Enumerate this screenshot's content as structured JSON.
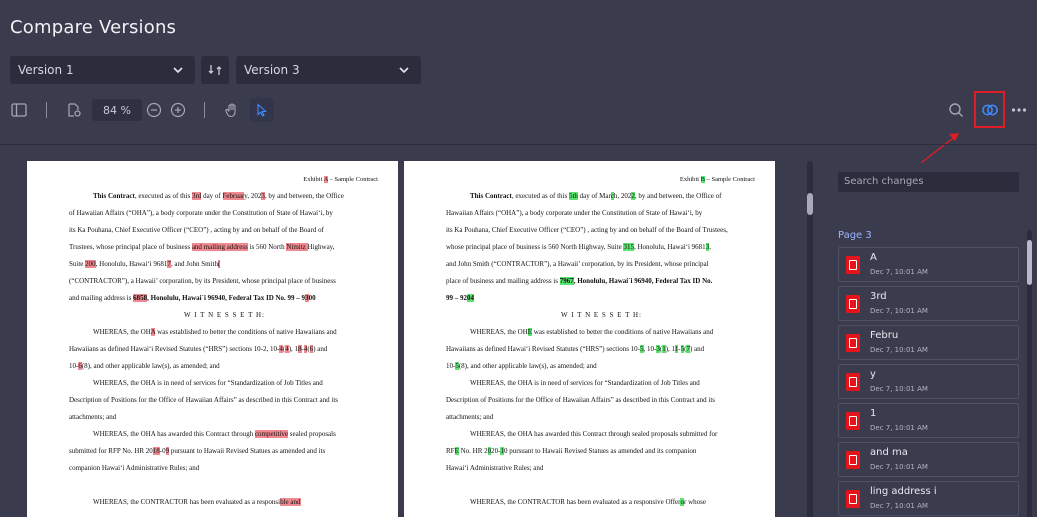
{
  "app": {
    "title": "Compare Versions"
  },
  "versions": {
    "left": "Version 1",
    "right": "Version 3"
  },
  "toolbar": {
    "zoom": "84 %"
  },
  "left_doc": {
    "exhibit_pre": "Exhibit ",
    "exhibit_hl": "A",
    "exhibit_post": " – Sample Contract",
    "l1a": "This Contract",
    "l1b": ", executed as of this ",
    "l1c": "3rd",
    "l1d": " day of ",
    "l1e": "Februar",
    "l1f": "y",
    "l1g": ", 202",
    "l1h": "3",
    "l1i": ", by and between, the Office",
    "l2": "of Hawaiian Affairs (“OHA”), a body corporate under the Constitution of State of Hawai‘i, by",
    "l3": "its Ka Pouhana, Chief Executive Officer (“CEO”) , acting by and on behalf of the Board of",
    "l4a": "Trustees, whose principal place of business ",
    "l4b": "and mailing address",
    "l4c": " is 560 North ",
    "l4d": "Nimitz ",
    "l4e": "Highway,",
    "l5a": "Suite ",
    "l5b": "200",
    "l5c": ", Honolulu, Hawai‘i 9681",
    "l5d": "7",
    "l5e": ", and John Smith",
    "l5f": "(",
    "l6": "(“CONTRACTOR”), a Hawaii’ corporation, by its President, whose principal place of business",
    "l7a": "and mailing address is ",
    "l7b": "6858",
    "l7c": ", Honolulu, Hawai`i  96940, Federal Tax ID No. 99 – 9",
    "l7d": "3",
    "l7e": "00",
    "wit": "W I T N E S S E T H:",
    "w1a": "WHEREAS, the OH",
    "w1b": "A",
    "w1c": " was established to better the conditions of native Hawaiians and",
    "w2a": "Hawaiians as defined Hawai‘i Revised Statutes (“HRS”) sections 10-2, 10-",
    "w2b": "4",
    "w2c": "(",
    "w2d": "4",
    "w2e": "), 1",
    "w2f": "8",
    "w2g": "-",
    "w2h": "4",
    "w2i": "(",
    "w2j": "6",
    "w2k": ") and",
    "w3a": "10-",
    "w3b": "6",
    "w3c": "(8), and other applicable law(s), as amended; and",
    "w4": "WHEREAS, the OHA is in need of services for “Standardization of Job Titles and",
    "w5": "Description of Positions for the Office of Hawaiian Affairs” as described in this Contract and its",
    "w6": "attachments; and",
    "w7a": "WHEREAS, the OHA has awarded this Contract through ",
    "w7b": "competitive",
    "w7c": " sealed proposals",
    "w8a": "submitted for RFP No. HR 20",
    "w8b": "18",
    "w8c": "-0",
    "w8d": "9",
    "w8e": " pursuant to Hawaii Revised Statues as amended and its",
    "w9": "companion Hawai‘i Administrative Rules; and",
    "w10a": "WHEREAS, the CONTRACTOR has been evaluated as a responsi",
    "w10b": "ble and"
  },
  "right_doc": {
    "exhibit_pre": "Exhibit ",
    "exhibit_hl": "B",
    "exhibit_post": " – Sample Contract",
    "l1a": "This Contract",
    "l1b": ", executed as of this ",
    "l1c": "5th",
    "l1d": " day of ",
    "l1e": "Mar",
    "l1f": "c",
    "l1g": "h",
    "l1h": ", 202",
    "l1i": "2",
    "l1j": ", by and between, the Office of",
    "l2": "Hawaiian Affairs (“OHA”), a body corporate under the Constitution of State of Hawai‘i, by",
    "l3": "its Ka Pouhana, Chief Executive Officer (“CEO”) , acting by and on behalf of the Board of Trustees,",
    "l4a": "whose principal place of business is 560 North Highway, Suite ",
    "l4b": "315",
    "l4c": ", Honolulu, Hawai‘i 9681",
    "l4d": "3",
    "l4e": ",",
    "l5": "and John Smith (“CONTRACTOR”), a Hawaii’ corporation, by its President, whose principal",
    "l6a": "place of business and mailing address is ",
    "l6b": "7967",
    "l6c": ", Honolulu, Hawai`i  96940, Federal Tax ID No.",
    "l7a": "99 – 92",
    "l7b": "04",
    "wit": "W I T N E S S E T H:",
    "w1a": "WHEREAS, the OH",
    "w1b": "E",
    "w1c": " was established to better the conditions of native Hawaiians and",
    "w2a": "Hawaiians as defined Hawai‘i Revised Statutes (“HRS”) sections 10-",
    "w2b": "5",
    "w2c": ", 10-",
    "w2d": "3",
    "w2e": "(",
    "w2f": "1",
    "w2g": "), 1",
    "w2h": "1",
    "w2i": "-",
    "w2j": "5",
    "w2k": "(",
    "w2l": "7",
    "w2m": ") and",
    "w3a": "10-",
    "w3b": "5",
    "w3c": "(8), and other applicable law(s), as amended; and",
    "w4": "WHEREAS, the OHA is in need of services for “Standardization of Job Titles and",
    "w5": "Description of Positions for the Office of Hawaiian Affairs” as described in this Contract and its",
    "w6": "attachments; and",
    "w7": "WHEREAS, the OHA has awarded this Contract through sealed proposals submitted for",
    "w8a": "RF",
    "w8b": "E",
    "w8c": " No. HR 2",
    "w8d": "0",
    "w8e": "20-",
    "w8f": "1",
    "w8g": "0 pursuant to Hawaii Revised Statues as amended and its companion",
    "w9": "Hawai‘i Administrative Rules; and",
    "w10a": "WHEREAS, the CONTRACTOR has been evaluated as a responsive Offer",
    "w10b": "o",
    "w10c": "r whose"
  },
  "sidebar": {
    "search_placeholder": "Search changes",
    "page_label": "Page 3",
    "changes": [
      {
        "text": "A",
        "date": "Dec 7, 10:01 AM"
      },
      {
        "text": "3rd",
        "date": "Dec 7, 10:01 AM"
      },
      {
        "text": "Febru",
        "date": "Dec 7, 10:01 AM"
      },
      {
        "text": "y",
        "date": "Dec 7, 10:01 AM"
      },
      {
        "text": "1",
        "date": "Dec 7, 10:01 AM"
      },
      {
        "text": "and ma",
        "date": "Dec 7, 10:01 AM"
      },
      {
        "text": "ling address i",
        "date": "Dec 7, 10:01 AM"
      }
    ]
  },
  "colors": {
    "removed": "#f08a90",
    "added": "#5be36f",
    "accent": "#3f8cff",
    "annotation": "#e01d24"
  }
}
